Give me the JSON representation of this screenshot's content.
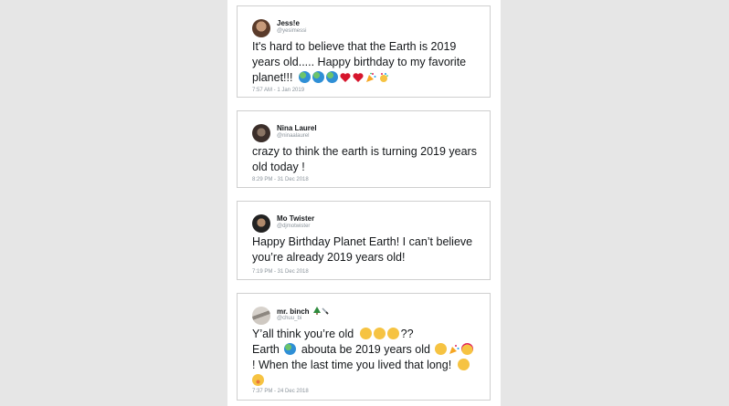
{
  "tweets": [
    {
      "name": "Jess!e",
      "handle": "@yesimessi",
      "text_line1": "It's hard to believe that the Earth is 2019",
      "text_line2": "years old..... Happy birthday to my favorite",
      "text_line3": "planet!!!",
      "time": "7:57 AM - 1 Jan 2019",
      "emoji": [
        "earth-globe",
        "earth-globe",
        "earth-globe",
        "red-heart",
        "red-heart",
        "party-popper",
        "confetti-ball"
      ]
    },
    {
      "name": "Nina Laurel",
      "handle": "@ninaalaurel",
      "text_line1": "crazy to think the earth is turning 2019 years",
      "text_line2": "old  today !",
      "time": "8:29 PM - 31 Dec 2018"
    },
    {
      "name": "Mo Twister",
      "handle": "@djmotwister",
      "text_line1": "Happy Birthday Planet Earth! I can’t believe",
      "text_line2": "you’re already 2019 years old!",
      "time": "7:19 PM - 31 Dec 2018"
    },
    {
      "name": "mr. binch",
      "handle": "@chuu_bi",
      "text_line1": "Y’all think you’re old",
      "text_line1_suffix": "??",
      "text_line2": "Earth",
      "text_line2_suffix": "abouta be 2019 years old",
      "text_line3": "! When the last time you lived that long!",
      "time": "7:37 PM - 24 Dec 2018",
      "name_emoji": [
        "christmas-tree",
        "knife"
      ]
    }
  ],
  "colors": {
    "background": "#e6e6e6",
    "card_border": "#cfcfcf",
    "text": "#14171a",
    "muted": "#8a939b",
    "earth": "#3aa0d8",
    "heart": "#d6152c",
    "emoji_yellow": "#f6c342"
  }
}
